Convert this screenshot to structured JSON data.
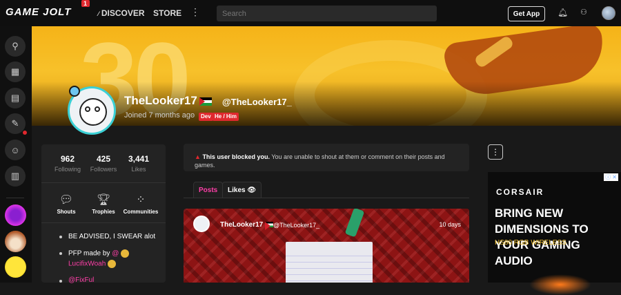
{
  "topbar": {
    "logo": "GAME JOLT",
    "logo_notification": "1",
    "discover": "DISCOVER",
    "store": "STORE",
    "more_icon": "⋮",
    "search_placeholder": "Search",
    "get_app": "Get App"
  },
  "profile": {
    "username": "TheLooker17",
    "handle": "@TheLooker17_",
    "joined": "Joined 7 months ago",
    "tags": [
      "Dev",
      "He / Him"
    ],
    "banner_text": "30"
  },
  "stats": [
    {
      "value": "962",
      "label": "Following"
    },
    {
      "value": "425",
      "label": "Followers"
    },
    {
      "value": "3,441",
      "label": "Likes"
    }
  ],
  "quicklinks": [
    {
      "label": "Shouts",
      "icon": "speech-bubble-icon"
    },
    {
      "label": "Trophies",
      "icon": "trophy-icon"
    },
    {
      "label": "Communities",
      "icon": "grid-dots-icon"
    }
  ],
  "bio": {
    "line1": "BE ADVISED, I SWEAR alot",
    "line2_prefix": "PFP made by",
    "line2_at": "@",
    "line2_name": "LucifixWoah",
    "line3": "@FixFul"
  },
  "blocked": {
    "bold": "This user blocked you.",
    "text": "You are unable to shout at them or comment on their posts and games."
  },
  "tabs": {
    "posts": "Posts",
    "likes": "Likes"
  },
  "post": {
    "user": "TheLooker17",
    "handle": "@TheLooker17_",
    "time": "10 days"
  },
  "ad": {
    "close": "ⓘ ✕",
    "brand": "CORSAIR",
    "headline": "BRING NEW DIMENSIONS TO YOUR GAMING AUDIO",
    "sub": "HS80 RGB WIRELESS"
  },
  "colors": {
    "accent_pink": "#ff3fa8",
    "alert_red": "#e0282e",
    "banner_yellow": "#f5b318"
  }
}
